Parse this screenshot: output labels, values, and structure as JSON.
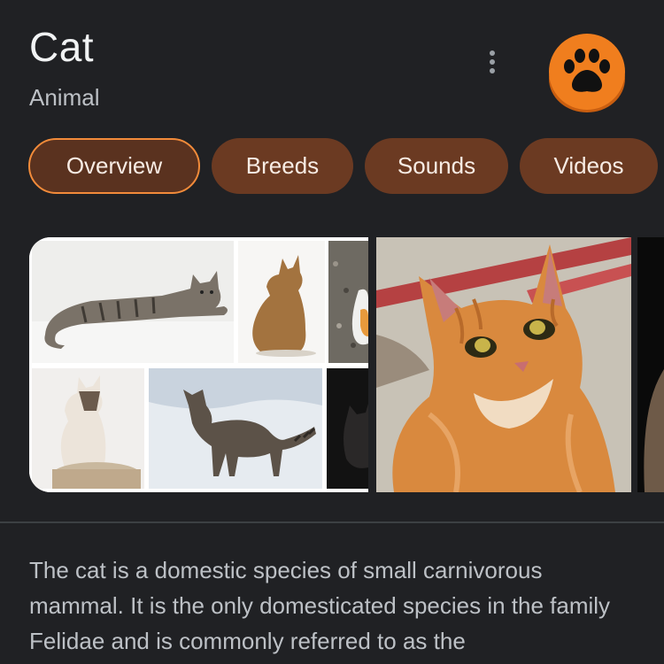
{
  "entity": {
    "title": "Cat",
    "subtitle": "Animal"
  },
  "header": {
    "more_icon": "more-vert-icon",
    "logo_icon": "paw-icon",
    "logo_color": "#f07e1e"
  },
  "tabs": [
    {
      "label": "Overview",
      "active": true
    },
    {
      "label": "Breeds",
      "active": false
    },
    {
      "label": "Sounds",
      "active": false
    },
    {
      "label": "Videos",
      "active": false
    }
  ],
  "colors": {
    "background": "#202124",
    "chip": "#6b3a22",
    "chip_active_border": "#f28b3a"
  },
  "description": "The cat is a domestic species of small carnivorous mammal. It is the only domesticated species in the family Felidae and is commonly referred to as the"
}
